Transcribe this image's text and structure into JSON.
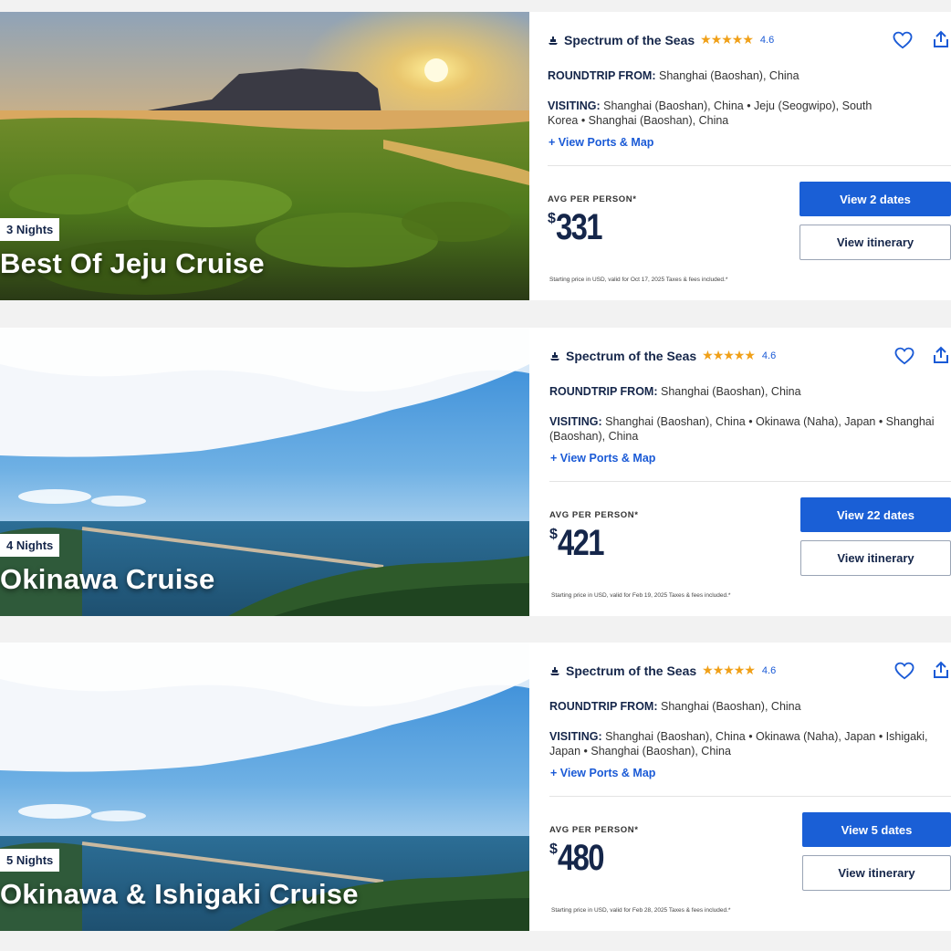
{
  "cards": [
    {
      "nights": "3 Nights",
      "title": "Best Of Jeju Cruise",
      "ship": "Spectrum of the Seas",
      "stars": "★★★★★",
      "rating": "4.6",
      "roundtrip_label": "ROUNDTRIP FROM:",
      "roundtrip_value": "Shanghai (Baoshan), China",
      "visiting_label": "VISITING:",
      "visiting_value": "Shanghai (Baoshan), China • Jeju (Seogwipo), South Korea • Shanghai (Baoshan), China",
      "ports_link": "+ View Ports & Map",
      "avg_label": "AVG PER PERSON*",
      "currency": "$",
      "price": "331",
      "dates_button": "View 2 dates",
      "itinerary_button": "View itinerary",
      "fine_print": "Starting price in USD, valid for Oct 17, 2025 Taxes & fees included.*",
      "heart_icon": "heart-icon",
      "share_icon": "share-icon"
    },
    {
      "nights": "4 Nights",
      "title": "Okinawa Cruise",
      "ship": "Spectrum of the Seas",
      "stars": "★★★★★",
      "rating": "4.6",
      "roundtrip_label": "ROUNDTRIP FROM:",
      "roundtrip_value": "Shanghai (Baoshan), China",
      "visiting_label": "VISITING:",
      "visiting_value": "Shanghai (Baoshan), China • Okinawa (Naha), Japan • Shanghai (Baoshan), China",
      "ports_link": "+ View Ports & Map",
      "avg_label": "AVG PER PERSON*",
      "currency": "$",
      "price": "421",
      "dates_button": "View 22 dates",
      "itinerary_button": "View itinerary",
      "fine_print": "Starting price in USD, valid for Feb 19, 2025 Taxes & fees included.*",
      "heart_icon": "heart-icon",
      "share_icon": "share-icon"
    },
    {
      "nights": "5 Nights",
      "title": "Okinawa & Ishigaki Cruise",
      "ship": "Spectrum of the Seas",
      "stars": "★★★★★",
      "rating": "4.6",
      "roundtrip_label": "ROUNDTRIP FROM:",
      "roundtrip_value": "Shanghai (Baoshan), China",
      "visiting_label": "VISITING:",
      "visiting_value": "Shanghai (Baoshan), China • Okinawa (Naha), Japan • Ishigaki, Japan • Shanghai (Baoshan), China",
      "ports_link": "+ View Ports & Map",
      "avg_label": "AVG PER PERSON*",
      "currency": "$",
      "price": "480",
      "dates_button": "View 5 dates",
      "itinerary_button": "View itinerary",
      "fine_print": "Starting price in USD, valid for Feb 28, 2025 Taxes & fees included.*",
      "heart_icon": "heart-icon",
      "share_icon": "share-icon"
    }
  ],
  "colors": {
    "primary_button": "#1a5fd6",
    "brand_navy": "#15264a",
    "star": "#f0a018",
    "link": "#1a5ad6"
  }
}
